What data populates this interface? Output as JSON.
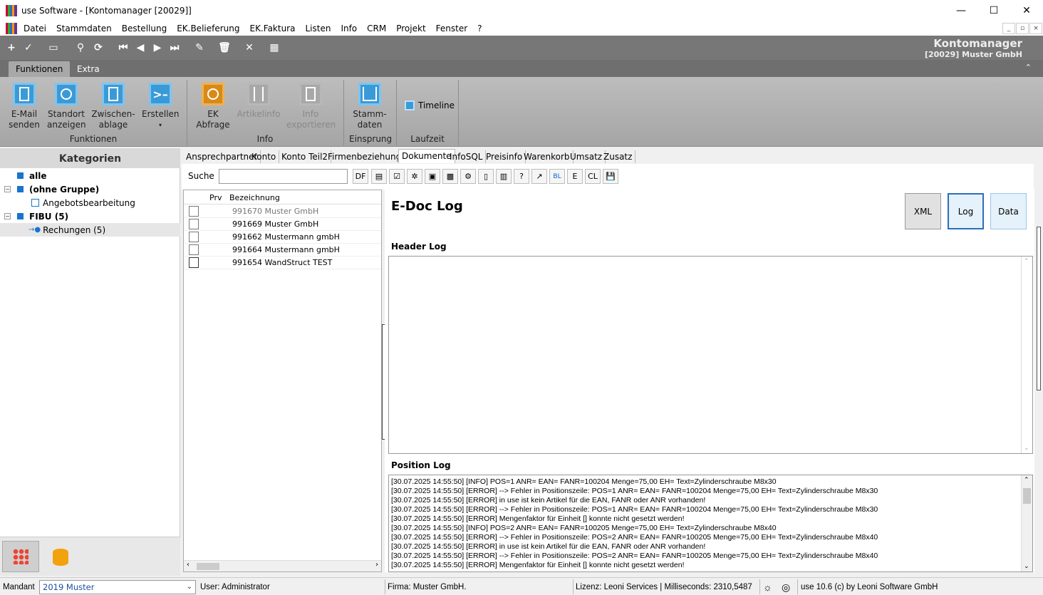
{
  "window": {
    "title": "use Software - [Kontomanager [20029]]",
    "minimize": "—",
    "maximize": "☐",
    "close": "✕"
  },
  "menu": [
    "Datei",
    "Stammdaten",
    "Bestellung",
    "EK.Belieferung",
    "EK.Faktura",
    "Listen",
    "Info",
    "CRM",
    "Projekt",
    "Fenster",
    "?"
  ],
  "header": {
    "title": "Kontomanager",
    "subtitle": "[20029] Muster GmbH"
  },
  "ribbon_tabs": [
    "Funktionen",
    "Extra"
  ],
  "ribbon": {
    "funktionen": {
      "label": "Funktionen",
      "email": "E-Mail\nsenden",
      "standort": "Standort\nanzeigen",
      "zwischen": "Zwischen-\nablage",
      "erstellen": "Erstellen"
    },
    "info": {
      "label": "Info",
      "ek": "EK\nAbfrage",
      "artikel": "Artikelinfo",
      "export": "Info\nexportieren"
    },
    "einsprung": {
      "label": "Einsprung",
      "stamm": "Stamm-\ndaten"
    },
    "laufzeit": {
      "label": "Laufzeit",
      "timeline": "Timeline"
    }
  },
  "kategorien": {
    "header": "Kategorien",
    "items": [
      "alle",
      "(ohne Gruppe)",
      "Angebotsbearbeitung",
      "FIBU (5)",
      "Rechungen (5)"
    ]
  },
  "doc_tabs": [
    "Ansprechpartner",
    "Konto",
    "Konto Teil2",
    "Firmenbeziehungen",
    "Dokumente",
    "InfoSQL",
    "Preisinfo",
    "Warenkorb",
    "Umsatz",
    "Zusatz"
  ],
  "search": {
    "label": "Suche",
    "value": ""
  },
  "doc_toolbar": [
    "DF",
    "E",
    "CL"
  ],
  "doclist": {
    "col_prv": "Prv",
    "col_bez": "Bezeichnung",
    "rows": [
      "991670 Muster GmbH",
      "991669 Muster GmbH",
      "991662 Mustermann gmbH",
      "991664 Mustermann gmbH",
      "991654 WandStruct TEST"
    ]
  },
  "edoc": {
    "title": "E-Doc Log",
    "buttons": [
      "XML",
      "Log",
      "Data"
    ],
    "header_log_label": "Header Log",
    "position_log_label": "Position Log",
    "position_log": [
      "[30.07.2025 14:55:50] [INFO] POS=1 ANR= EAN= FANR=100204 Menge=75,00 EH= Text=Zylinderschraube M8x30",
      "[30.07.2025 14:55:50] [ERROR]    --> Fehler in Positionszeile: POS=1 ANR= EAN= FANR=100204 Menge=75,00 EH= Text=Zylinderschraube M8x30",
      "[30.07.2025 14:55:50] [ERROR] in use ist kein Artikel für die EAN, FANR oder ANR vorhanden!",
      "[30.07.2025 14:55:50] [ERROR]    --> Fehler in Positionszeile: POS=1 ANR= EAN= FANR=100204 Menge=75,00 EH= Text=Zylinderschraube M8x30",
      "[30.07.2025 14:55:50] [ERROR] Mengenfaktor für Einheit [] konnte nicht gesetzt werden!",
      "[30.07.2025 14:55:50] [INFO] POS=2 ANR= EAN= FANR=100205 Menge=75,00 EH= Text=Zylinderschraube M8x40",
      "[30.07.2025 14:55:50] [ERROR]    --> Fehler in Positionszeile: POS=2 ANR= EAN= FANR=100205 Menge=75,00 EH= Text=Zylinderschraube M8x40",
      "[30.07.2025 14:55:50] [ERROR] in use ist kein Artikel für die EAN, FANR oder ANR vorhanden!",
      "[30.07.2025 14:55:50] [ERROR]    --> Fehler in Positionszeile: POS=2 ANR= EAN= FANR=100205 Menge=75,00 EH= Text=Zylinderschraube M8x40",
      "[30.07.2025 14:55:50] [ERROR] Mengenfaktor für Einheit [] konnte nicht gesetzt werden!"
    ]
  },
  "status": {
    "mandant_label": "Mandant",
    "mandant_value": "2019 Muster",
    "user": "User: Administrator",
    "firma": "Firma: Muster GmbH.",
    "lizenz": "Lizenz: Leoni Services | Milliseconds: 2310,5487",
    "version": "use 10.6 (c) by Leoni Software GmbH"
  },
  "colors": {
    "accent": "#3a9ad8",
    "toolbar": "#777777",
    "select_blue": "#1874cd"
  }
}
